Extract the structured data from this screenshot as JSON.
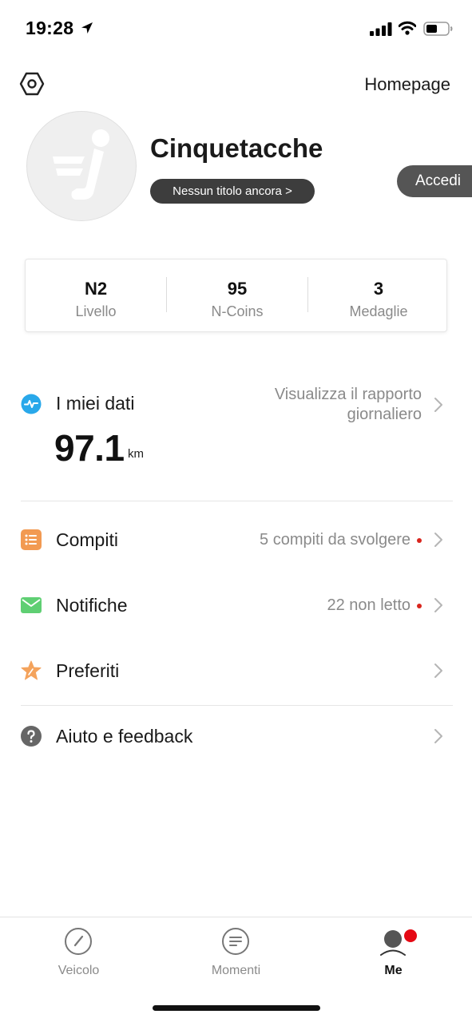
{
  "status_bar": {
    "time": "19:28",
    "icons": [
      "location-arrow-icon",
      "cellular-signal-icon",
      "wifi-icon",
      "battery-icon"
    ]
  },
  "header": {
    "settings_icon": "hexagon-settings-icon",
    "homepage_label": "Homepage"
  },
  "profile": {
    "username": "Cinquetacche",
    "title_badge": "Nessun titolo ancora >",
    "login_label": "Accedi"
  },
  "stats": [
    {
      "value": "N2",
      "label": "Livello"
    },
    {
      "value": "95",
      "label": "N-Coins"
    },
    {
      "value": "3",
      "label": "Medaglie"
    }
  ],
  "my_data": {
    "title": "I miei dati",
    "report_line1": "Visualizza il rapporto",
    "report_line2": "giornaliero",
    "distance_value": "97.1",
    "distance_unit": "km"
  },
  "menu": [
    {
      "label": "Compiti",
      "detail": "5 compiti da svolgere",
      "icon": "task-list-icon",
      "has_dot": true
    },
    {
      "label": "Notifiche",
      "detail": "22 non letto",
      "icon": "envelope-icon",
      "has_dot": true
    },
    {
      "label": "Preferiti",
      "detail": "",
      "icon": "star-icon",
      "has_dot": false
    },
    {
      "label": "Aiuto e feedback",
      "detail": "",
      "icon": "help-icon",
      "has_dot": false
    }
  ],
  "tabs": [
    {
      "label": "Veicolo",
      "icon": "speedometer-icon",
      "active": false
    },
    {
      "label": "Momenti",
      "icon": "moments-icon",
      "active": false
    },
    {
      "label": "Me",
      "icon": "profile-icon",
      "active": true
    }
  ],
  "colors": {
    "accent_red": "#d9251d",
    "data_icon": "#29a8ea",
    "tasks_icon": "#f29a52",
    "notifications_icon": "#5fcf73",
    "favorites_icon": "#f4a35c",
    "help_icon": "#666666"
  }
}
